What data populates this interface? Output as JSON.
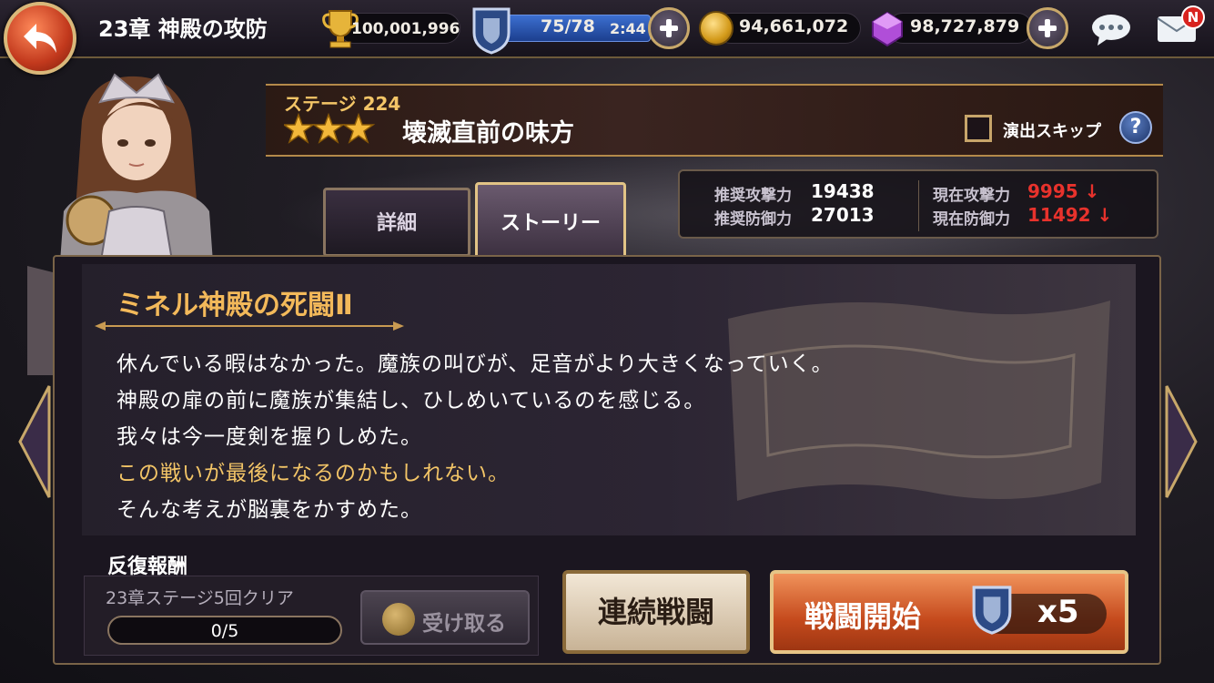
{
  "header": {
    "chapter_title": "23章 神殿の攻防",
    "trophy_value": "100,001,996",
    "stamina": "75/78",
    "stamina_timer": "2:44",
    "gold": "94,661,072",
    "gems": "98,727,879",
    "mail_badge": "N"
  },
  "stage": {
    "number_label": "ステージ 224",
    "star_count": 3,
    "name": "壊滅直前の味方",
    "skip_label": "演出スキップ",
    "help_label": "?"
  },
  "power": {
    "rec_attack_label": "推奨攻撃力",
    "rec_attack_value": "19438",
    "rec_defense_label": "推奨防御力",
    "rec_defense_value": "27013",
    "cur_attack_label": "現在攻撃力",
    "cur_attack_value": "9995 ↓",
    "cur_defense_label": "現在防御力",
    "cur_defense_value": "11492 ↓"
  },
  "tabs": {
    "detail": "詳細",
    "story": "ストーリー"
  },
  "story": {
    "title": "ミネル神殿の死闘Ⅱ",
    "lines": [
      "休んでいる暇はなかった。魔族の叫びが、足音がより大きくなっていく。",
      "神殿の扉の前に魔族が集結し、ひしめいているのを感じる。",
      "我々は今一度剣を握りしめた。",
      "この戦いが最後になるのかもしれない。",
      "そんな考えが脳裏をかすめた。"
    ]
  },
  "reward": {
    "label": "反復報酬",
    "condition": "23章ステージ5回クリア",
    "progress": "0/5",
    "progress_fraction": 0,
    "receive_label": "受け取る"
  },
  "actions": {
    "continuous_label": "連続戦闘",
    "battle_label": "戦闘開始",
    "battle_cost": "x5"
  },
  "colors": {
    "gold_text": "#f3c567",
    "warning_red": "#e8322c",
    "battle_button": "#c54a1d"
  }
}
